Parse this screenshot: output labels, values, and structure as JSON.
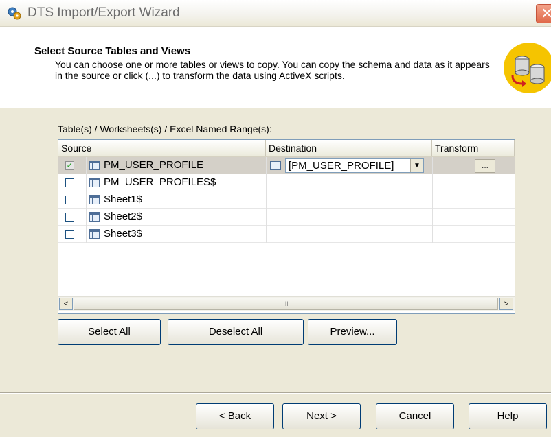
{
  "window": {
    "title": "DTS Import/Export Wizard",
    "close_glyph": "✕"
  },
  "header": {
    "title": "Select Source Tables and Views",
    "description": "You can choose one or more tables or views to copy.  You can copy the schema and data as it appears in the source or click (...) to transform the data using ActiveX scripts."
  },
  "grid": {
    "label": "Table(s) / Worksheets(s) / Excel Named Range(s):",
    "columns": [
      "Source",
      "Destination",
      "Transform"
    ],
    "rows": [
      {
        "checked": true,
        "source": "PM_USER_PROFILE",
        "destination": "[PM_USER_PROFILE]",
        "transform": "..."
      },
      {
        "checked": false,
        "source": "PM_USER_PROFILES$",
        "destination": "",
        "transform": ""
      },
      {
        "checked": false,
        "source": "Sheet1$",
        "destination": "",
        "transform": ""
      },
      {
        "checked": false,
        "source": "Sheet2$",
        "destination": "",
        "transform": ""
      },
      {
        "checked": false,
        "source": "Sheet3$",
        "destination": "",
        "transform": ""
      }
    ],
    "scroll_left": "<",
    "scroll_right": ">",
    "thumb_grip": "III"
  },
  "actions": {
    "select_all": "Select All",
    "deselect_all": "Deselect All",
    "preview": "Preview..."
  },
  "footer": {
    "back": "< Back",
    "next": "Next >",
    "cancel": "Cancel",
    "help": "Help"
  },
  "icons": {
    "title": "wizard-gear-icon",
    "header": "database-transfer-icon",
    "table": "table-icon"
  }
}
